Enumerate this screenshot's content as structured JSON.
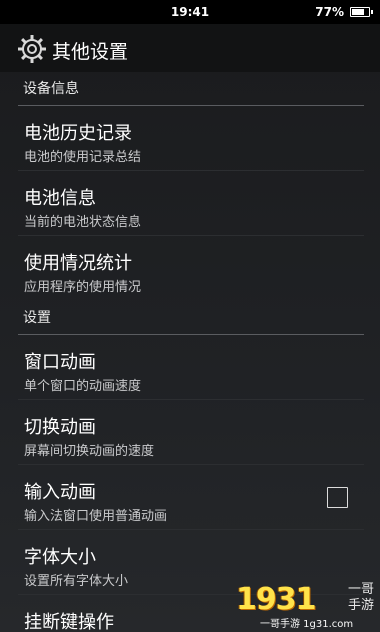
{
  "status_bar": {
    "time": "19:41",
    "battery_percent": "77%",
    "battery_level": 0.77
  },
  "action_bar": {
    "title": "其他设置",
    "icon": "gear-icon"
  },
  "sections": [
    {
      "header": "设备信息",
      "items": [
        {
          "title": "电池历史记录",
          "summary": "电池的使用记录总结"
        },
        {
          "title": "电池信息",
          "summary": "当前的电池状态信息"
        },
        {
          "title": "使用情况统计",
          "summary": "应用程序的使用情况"
        }
      ]
    },
    {
      "header": "设置",
      "items": [
        {
          "title": "窗口动画",
          "summary": "单个窗口的动画速度"
        },
        {
          "title": "切换动画",
          "summary": "屏幕间切换动画的速度"
        },
        {
          "title": "输入动画",
          "summary": "输入法窗口使用普通动画",
          "checkbox": false
        },
        {
          "title": "字体大小",
          "summary": "设置所有字体大小"
        },
        {
          "title": "挂断键操作",
          "summary": ""
        }
      ]
    }
  ],
  "watermark": {
    "digits": "1931",
    "side_text_1": "一哥",
    "side_text_2": "手游",
    "url": "一哥手游 1g31.com"
  }
}
